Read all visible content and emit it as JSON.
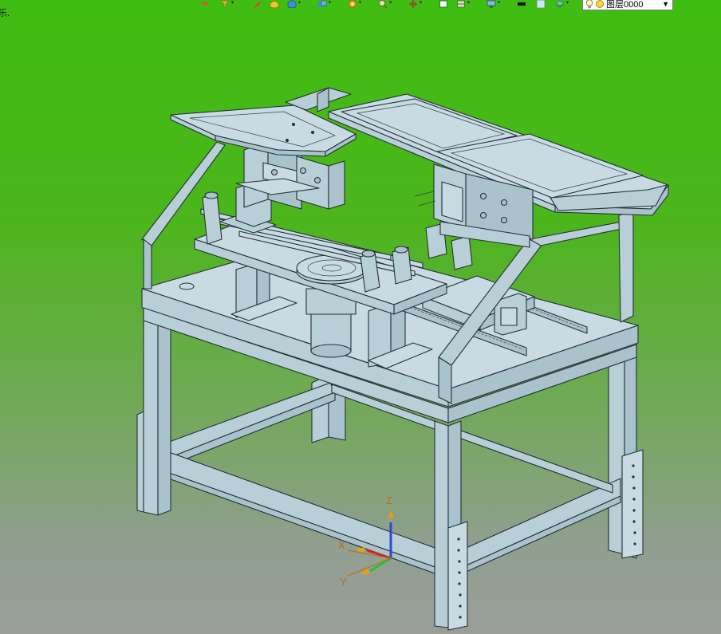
{
  "app": {
    "left_fragment": "乐.",
    "layer_select": {
      "value": "图层0000"
    }
  },
  "toolbar": {
    "icons": [
      "undo-icon",
      "filter-icon",
      "pencil-icon",
      "block-yellow-icon",
      "cube-blue-icon",
      "cube-multi-icon",
      "gear-orange-icon",
      "zoom-icon",
      "rotate-icon",
      "box-green-icon",
      "section-icon",
      "monitor-icon",
      "black-rect-icon",
      "blank-rect-icon",
      "layers-icon"
    ]
  },
  "triad": {
    "x_label": "X",
    "y_label": "Y",
    "z_label": "Z"
  },
  "colors": {
    "model_fill": "#b8cdd6",
    "model_stroke": "#2a3438",
    "bg_top": "#3fbd12",
    "bg_bottom": "#9a9e9a"
  }
}
